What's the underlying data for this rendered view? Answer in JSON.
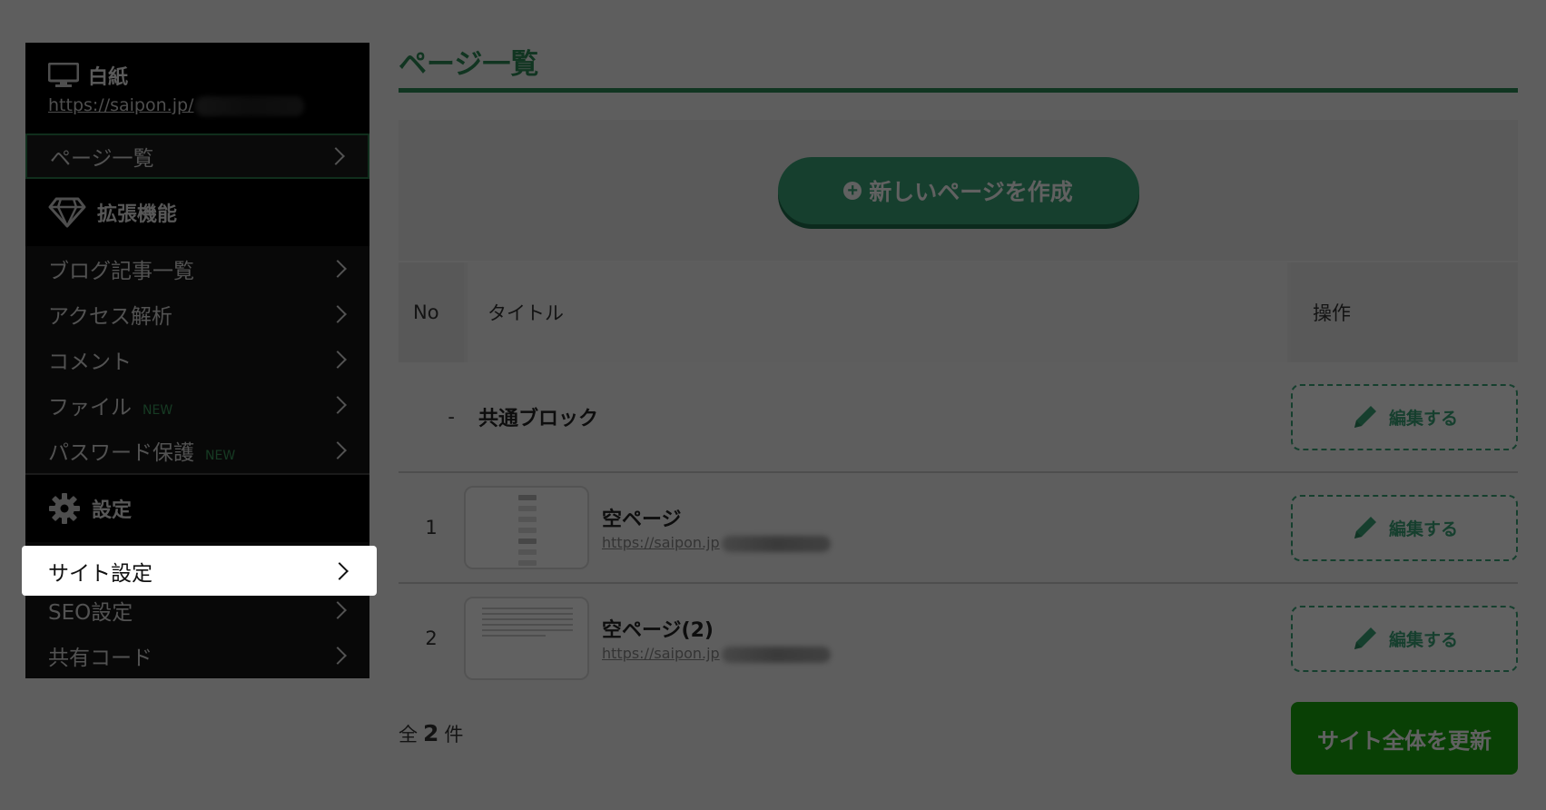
{
  "site": {
    "name": "白紙",
    "url": "https://saipon.jp/"
  },
  "nav": {
    "pages": "ページ一覧",
    "ext_section": "拡張機能",
    "ext_items": [
      {
        "label": "ブログ記事一覧",
        "badge": ""
      },
      {
        "label": "アクセス解析",
        "badge": ""
      },
      {
        "label": "コメント",
        "badge": ""
      },
      {
        "label": "ファイル",
        "badge": "NEW"
      },
      {
        "label": "パスワード保護",
        "badge": "NEW"
      }
    ],
    "settings_section": "設定",
    "settings_items": [
      {
        "label": "サイト設定"
      },
      {
        "label": "SEO設定"
      },
      {
        "label": "共有コード"
      }
    ]
  },
  "main": {
    "title": "ページ一覧",
    "create_label": "新しいページを作成",
    "headers": {
      "no": "No",
      "title": "タイトル",
      "op": "操作"
    },
    "common_block": {
      "dash": "-",
      "label": "共通ブロック"
    },
    "rows": [
      {
        "no": "1",
        "title": "空ページ",
        "url": "https://saipon.jp"
      },
      {
        "no": "2",
        "title": "空ページ(2)",
        "url": "https://saipon.jp"
      }
    ],
    "edit_label": "編集する",
    "count": {
      "prefix": "全",
      "num": "2",
      "suffix": "件"
    },
    "update_label": "サイト全体を更新"
  },
  "colors": {
    "accent": "#2e8b57",
    "update": "#1aa80e",
    "sidebar": "#161616"
  }
}
